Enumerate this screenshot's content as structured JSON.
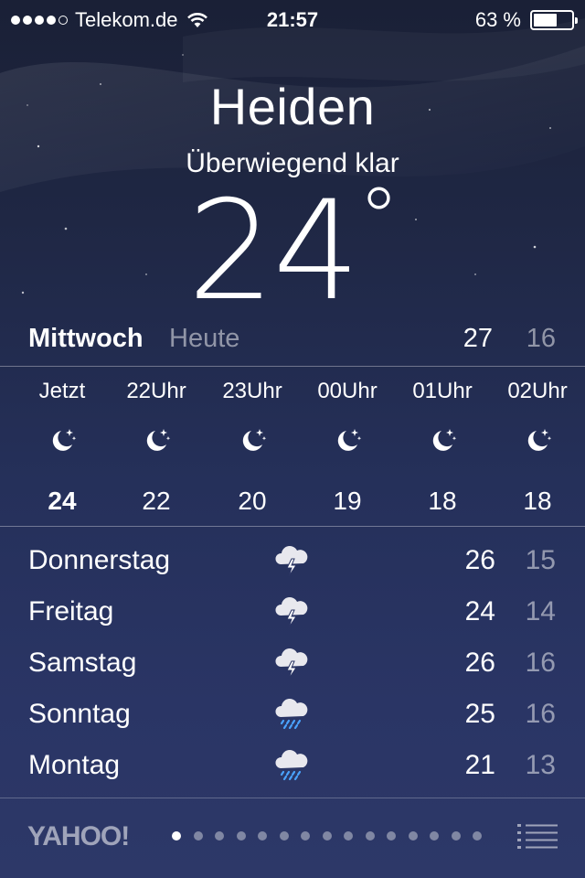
{
  "status_bar": {
    "carrier": "Telekom.de",
    "time": "21:57",
    "battery": "63 %",
    "battery_level": 0.63,
    "signal_bars": 4,
    "signal_max": 5
  },
  "location": {
    "city": "Heiden",
    "condition": "Überwiegend klar",
    "temperature": "24",
    "degree": "°"
  },
  "today": {
    "day": "Mittwoch",
    "label": "Heute",
    "high": "27",
    "low": "16"
  },
  "hourly": [
    {
      "time": "Jetzt",
      "icon": "moon-stars-icon",
      "temp": "24"
    },
    {
      "time": "22Uhr",
      "icon": "moon-stars-icon",
      "temp": "22"
    },
    {
      "time": "23Uhr",
      "icon": "moon-stars-icon",
      "temp": "20"
    },
    {
      "time": "00Uhr",
      "icon": "moon-stars-icon",
      "temp": "19"
    },
    {
      "time": "01Uhr",
      "icon": "moon-stars-icon",
      "temp": "18"
    },
    {
      "time": "02Uhr",
      "icon": "moon-stars-icon",
      "temp": "18"
    }
  ],
  "daily": [
    {
      "day": "Donnerstag",
      "icon": "thunderstorm-icon",
      "high": "26",
      "low": "15"
    },
    {
      "day": "Freitag",
      "icon": "thunderstorm-icon",
      "high": "24",
      "low": "14"
    },
    {
      "day": "Samstag",
      "icon": "thunderstorm-icon",
      "high": "26",
      "low": "16"
    },
    {
      "day": "Sonntag",
      "icon": "rain-cloud-icon",
      "high": "25",
      "low": "16"
    },
    {
      "day": "Montag",
      "icon": "rain-cloud-icon",
      "high": "21",
      "low": "13"
    }
  ],
  "footer": {
    "brand": "YAHOO!",
    "page_count": 15,
    "active_page": 1
  },
  "colors": {
    "rain_drops": "#4aa3ff",
    "dim_text": "rgba(255,255,255,0.5)"
  }
}
